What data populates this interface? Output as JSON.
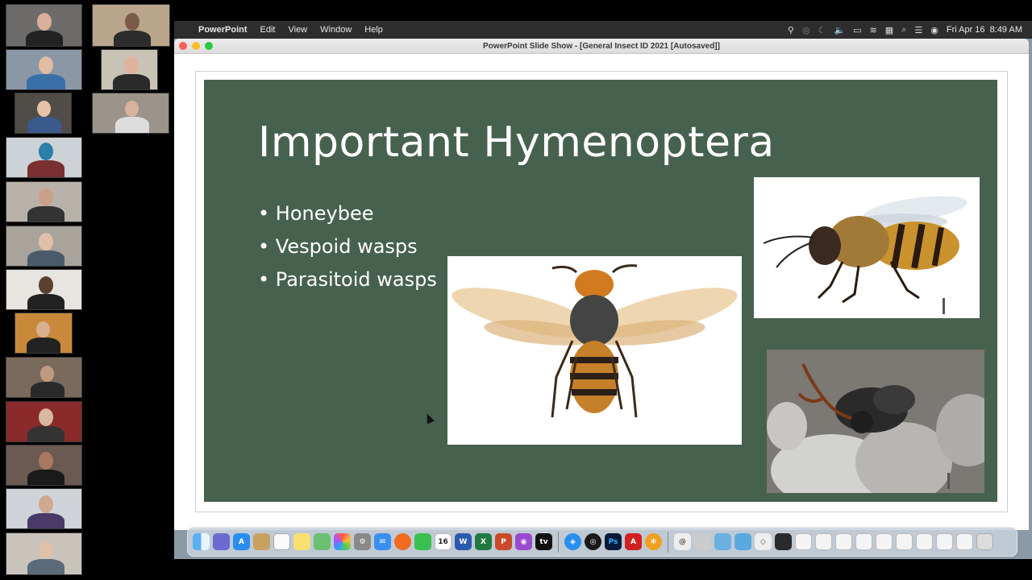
{
  "menubar": {
    "app_name": "PowerPoint",
    "menus": [
      "Edit",
      "View",
      "Window",
      "Help"
    ],
    "clock": "Fri Apr 16  8:49 AM"
  },
  "window": {
    "title": "PowerPoint Slide Show - [General Insect ID 2021 [Autosaved]]"
  },
  "slide": {
    "title": "Important Hymenoptera",
    "bullets": [
      "Honeybee",
      "Vespoid wasps",
      "Parasitoid wasps"
    ],
    "images": [
      "hornet-photo",
      "honeybee-photo",
      "parasitoid-wasp-photo"
    ],
    "background_color": "#47614f"
  },
  "dock": {
    "calendar_day": "16",
    "apps": [
      "Finder",
      "Launchpad",
      "App Store",
      "Notes",
      "Reminders",
      "Maps",
      "Photos",
      "System Preferences",
      "Mail",
      "Firefox",
      "Messages",
      "Calendar",
      "Word",
      "Excel",
      "PowerPoint",
      "Podcasts",
      "TV",
      "Safari",
      "Zoom",
      "Photoshop",
      "Acrobat",
      "Finder Folder"
    ]
  },
  "gallery": {
    "participant_count": 17
  }
}
